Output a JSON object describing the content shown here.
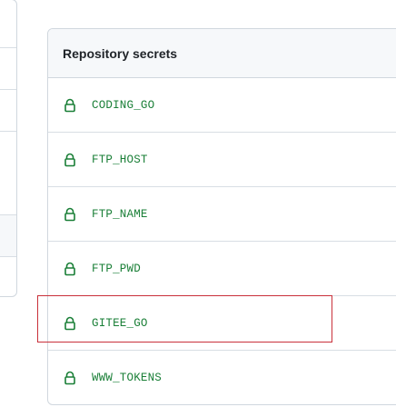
{
  "secrets": {
    "header": "Repository secrets",
    "items": [
      {
        "name": "CODING_GO",
        "icon": "lock-icon"
      },
      {
        "name": "FTP_HOST",
        "icon": "lock-icon"
      },
      {
        "name": "FTP_NAME",
        "icon": "lock-icon"
      },
      {
        "name": "FTP_PWD",
        "icon": "lock-icon"
      },
      {
        "name": "GITEE_GO",
        "icon": "lock-icon"
      },
      {
        "name": "WWW_TOKENS",
        "icon": "lock-icon"
      }
    ]
  },
  "colors": {
    "secret_name": "#1a7f37",
    "highlight": "#c9303a",
    "header_bg": "#f6f8fa",
    "border": "#d0d7de"
  }
}
